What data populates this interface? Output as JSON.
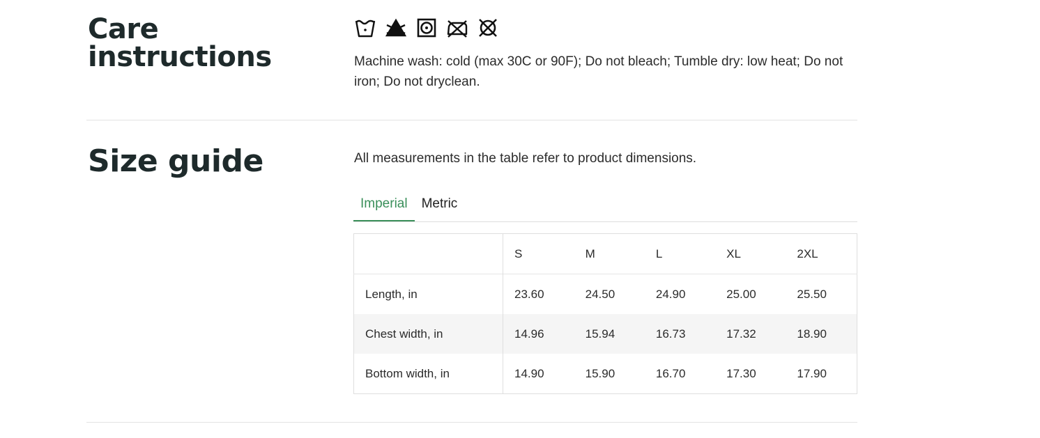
{
  "care": {
    "title": "Care instructions",
    "icons": [
      "wash-cold-icon",
      "do-not-bleach-icon",
      "tumble-dry-low-icon",
      "do-not-iron-icon",
      "do-not-dryclean-icon"
    ],
    "text": "Machine wash: cold (max 30C or 90F); Do not bleach; Tumble dry: low heat; Do not iron; Do not dryclean."
  },
  "size_guide": {
    "title": "Size guide",
    "description": "All measurements in the table refer to product dimensions.",
    "tabs": [
      {
        "label": "Imperial",
        "active": true
      },
      {
        "label": "Metric",
        "active": false
      }
    ],
    "table": {
      "columns": [
        "",
        "S",
        "M",
        "L",
        "XL",
        "2XL"
      ],
      "rows": [
        {
          "label": "Length, in",
          "values": [
            "23.60",
            "24.50",
            "24.90",
            "25.00",
            "25.50"
          ]
        },
        {
          "label": "Chest width, in",
          "values": [
            "14.96",
            "15.94",
            "16.73",
            "17.32",
            "18.90"
          ]
        },
        {
          "label": "Bottom width, in",
          "values": [
            "14.90",
            "15.90",
            "16.70",
            "17.30",
            "17.90"
          ]
        }
      ]
    }
  },
  "colors": {
    "heading": "#1e2a2b",
    "accent": "#3a8f5a",
    "divider": "#e3e3e3",
    "zebra_row": "#f5f5f5"
  }
}
